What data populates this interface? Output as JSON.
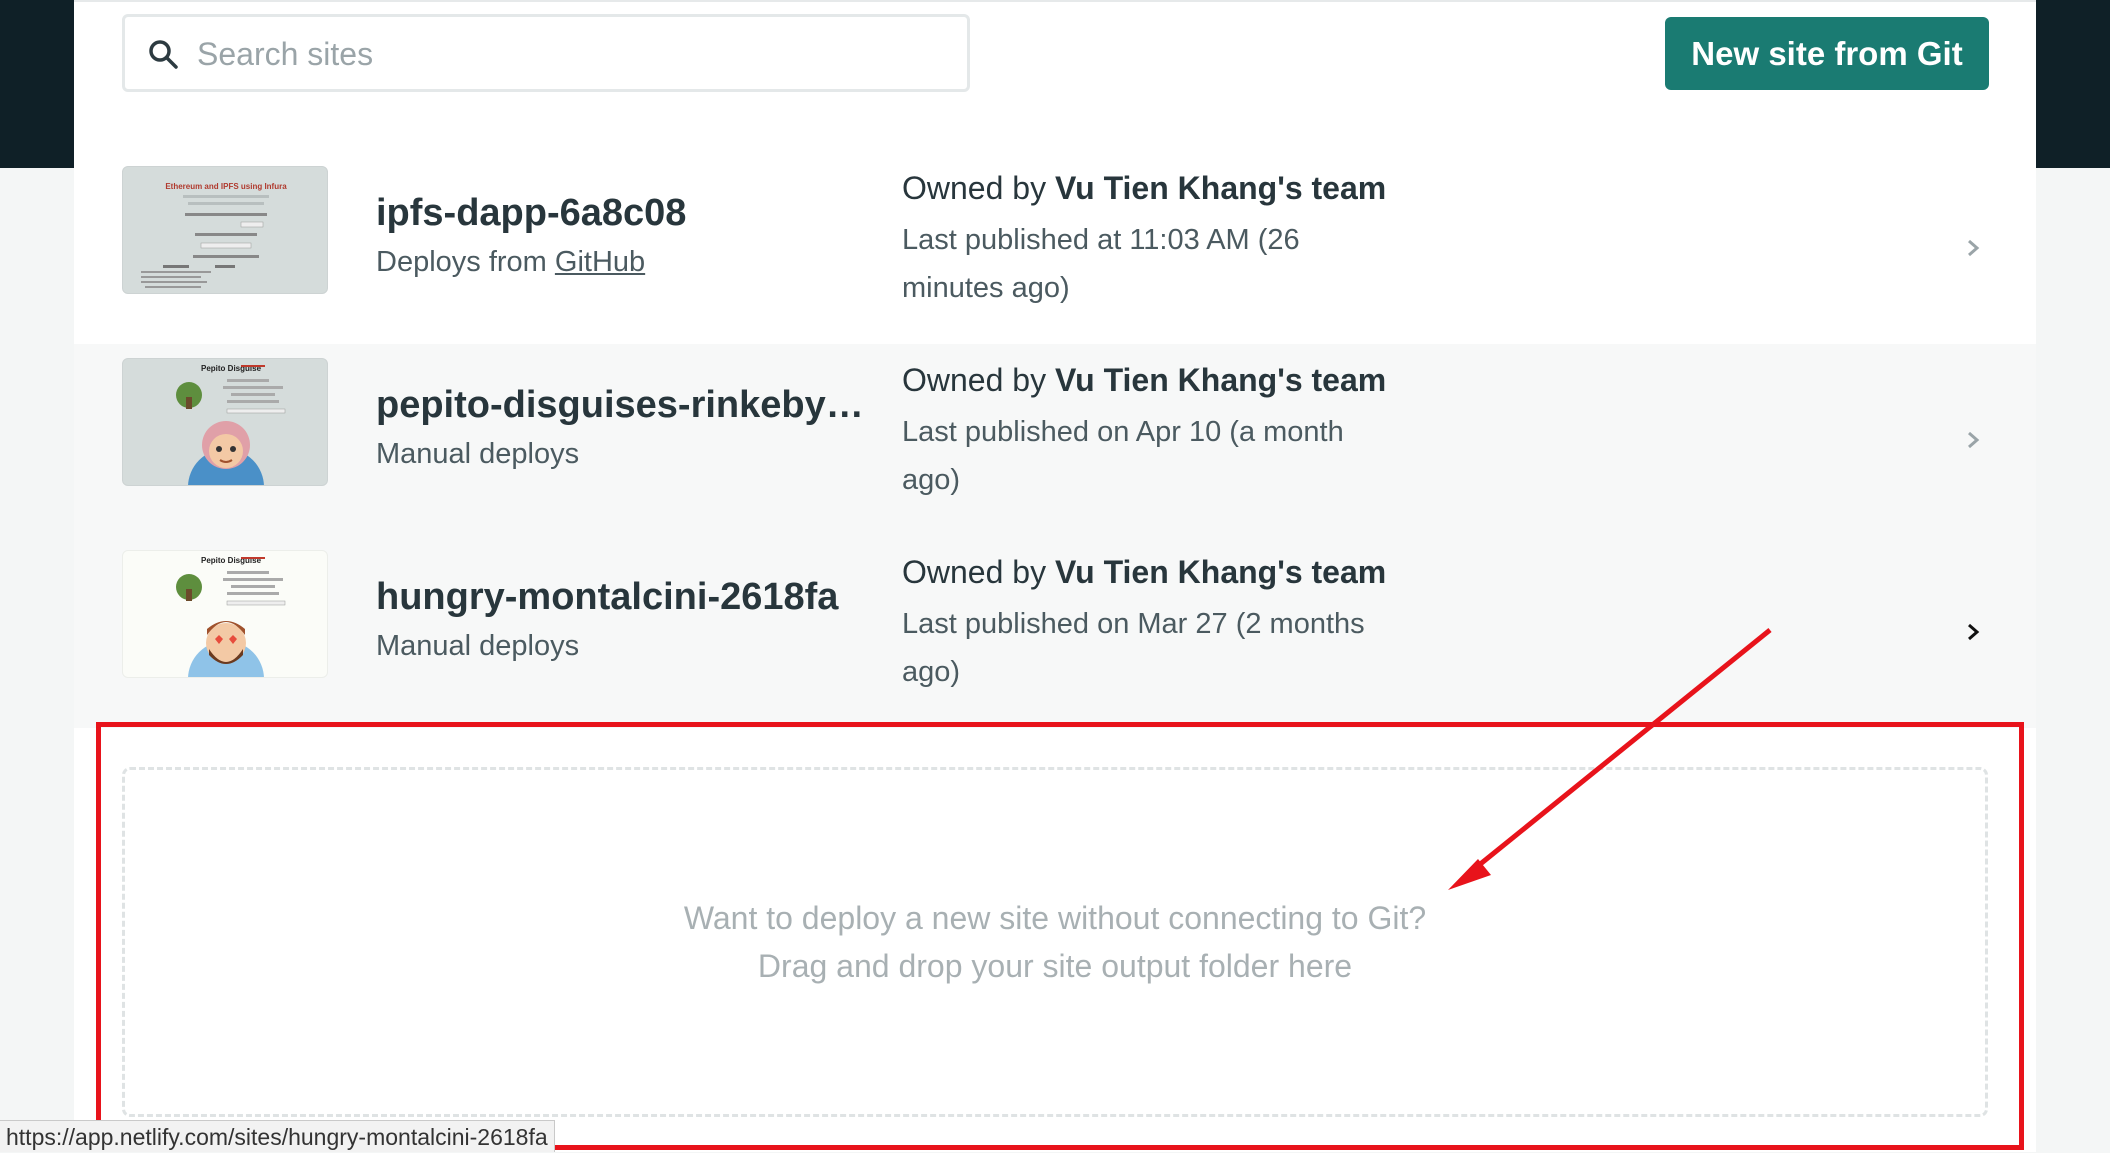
{
  "search": {
    "placeholder": "Search sites"
  },
  "new_site_button": "New site from Git",
  "sites": [
    {
      "name": "ipfs-dapp-6a8c08",
      "deploy_prefix": "Deploys from ",
      "deploy_link": "GitHub",
      "owner_prefix": "Owned by ",
      "owner_team": "Vu Tien Khang's team",
      "published": "Last published at 11:03 AM (26 minutes ago)",
      "thumb_title": "Ethereum and IPFS using Infura"
    },
    {
      "name": "pepito-disguises-rinkeby-v...",
      "deploy": "Manual deploys",
      "owner_prefix": "Owned by ",
      "owner_team": "Vu Tien Khang's team",
      "published": "Last published on Apr 10 (a month ago)",
      "thumb_title": "Pepito Disguise"
    },
    {
      "name": "hungry-montalcini-2618fa",
      "deploy": "Manual deploys",
      "owner_prefix": "Owned by ",
      "owner_team": "Vu Tien Khang's team",
      "published": "Last published on Mar 27 (2 months ago)",
      "thumb_title": "Pepito Disguise"
    }
  ],
  "drop_zone": {
    "line1": "Want to deploy a new site without connecting to Git?",
    "line2": "Drag and drop your site output folder here"
  },
  "status_url": "https://app.netlify.com/sites/hungry-montalcini-2618fa",
  "colors": {
    "accent": "#1a7b72",
    "annotation": "#e8131b",
    "dark_header": "#0f2027"
  }
}
